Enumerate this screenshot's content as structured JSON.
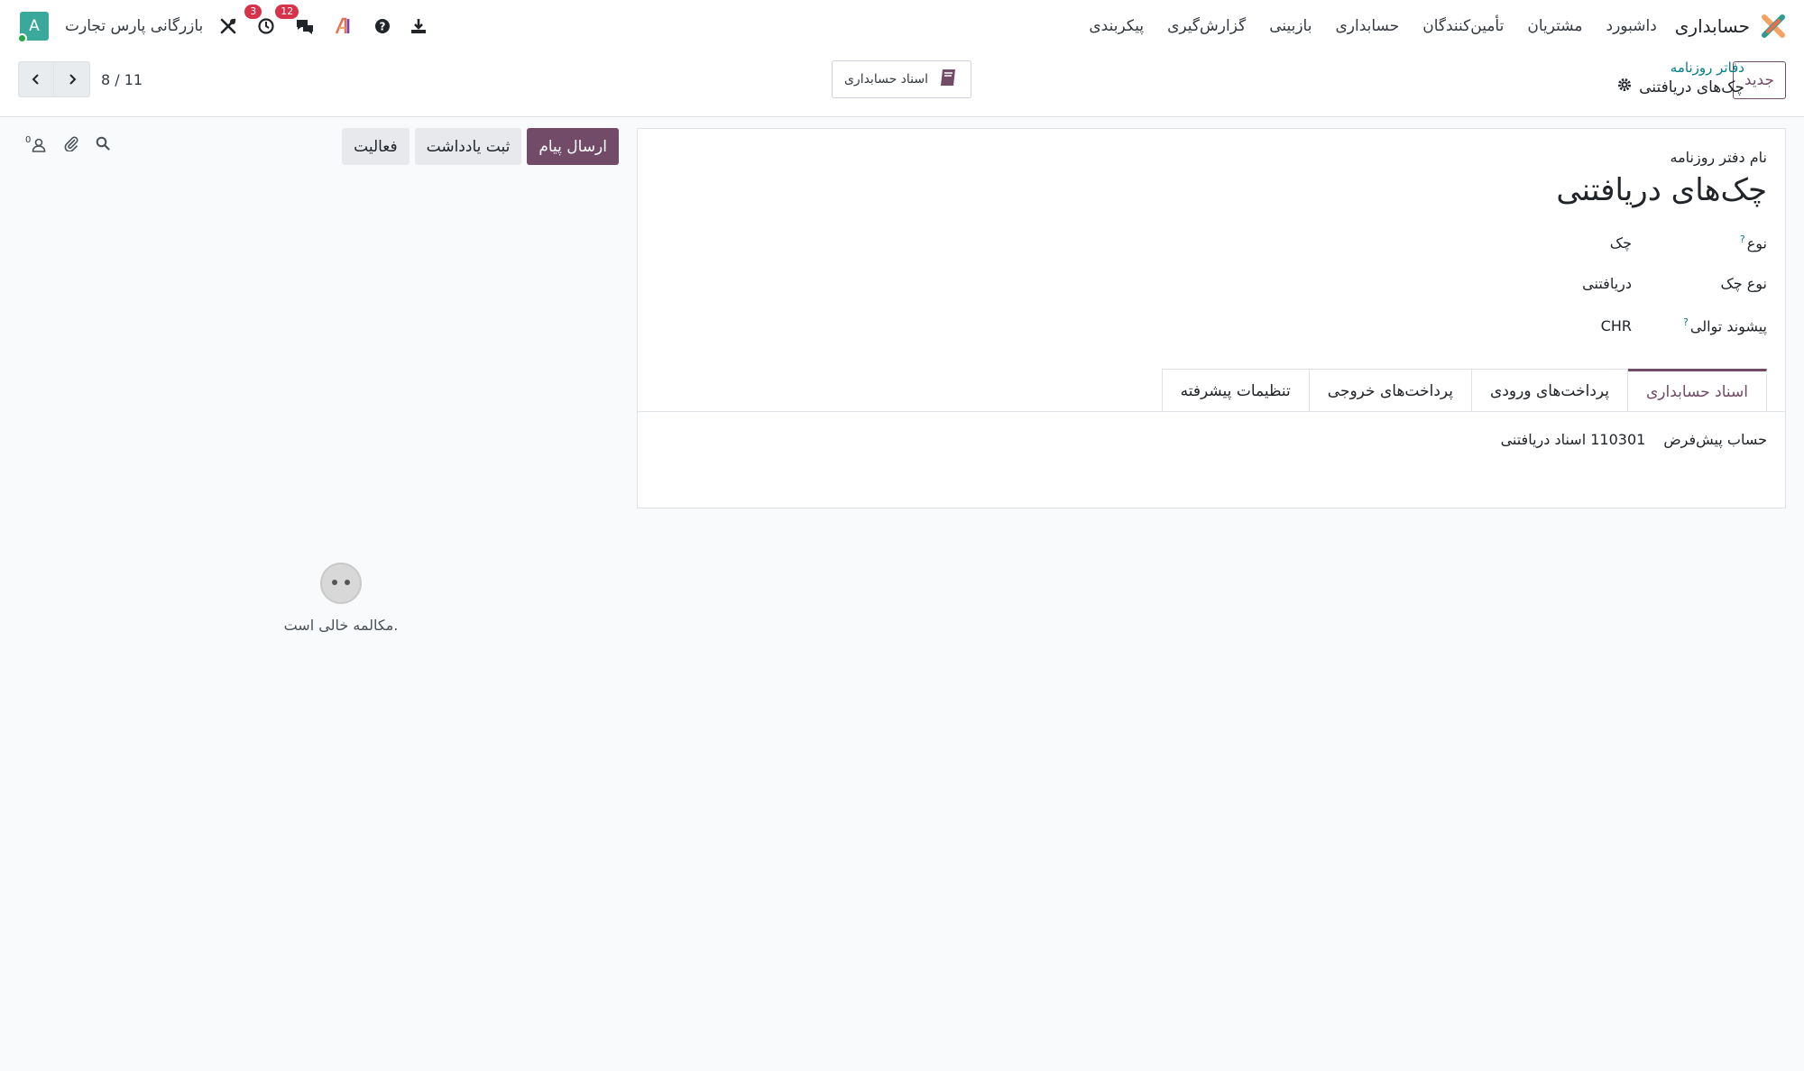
{
  "navbar": {
    "app_name": "حسابداری",
    "menu": [
      "داشبورد",
      "مشتریان",
      "تأمین‌کنندگان",
      "حسابداری",
      "بازبینی",
      "گزارش‌گیری",
      "پیکربندی"
    ],
    "company": "بازرگانی پارس تجارت",
    "avatar_letter": "A",
    "activity_badge": "3",
    "messages_badge": "12"
  },
  "control": {
    "new_button": "جدید",
    "breadcrumb_parent": "دفاتر روزنامه",
    "breadcrumb_current": "چک‌های دریافتنی",
    "smart_button": "اسناد حسابداری",
    "pager_value": "8 / 11"
  },
  "form": {
    "name_label": "نام دفتر روزنامه",
    "name_value": "چک‌های دریافتنی",
    "type_label": "نوع",
    "type_help": "?",
    "type_value": "چک",
    "check_type_label": "نوع چک",
    "check_type_value": "دریافتنی",
    "prefix_label": "پیشوند توالی",
    "prefix_help": "?",
    "prefix_value": "CHR",
    "tabs": [
      "اسناد حسابداری",
      "پرداخت‌های ورودی",
      "پرداخت‌های خروجی",
      "تنظیمات پیشرفته"
    ],
    "default_account_label": "حساب پیش‌فرض",
    "default_account_value": "110301 اسناد دریافتنی"
  },
  "chatter": {
    "send_message": "ارسال پیام",
    "log_note": "ثبت یادداشت",
    "activity": "فعالیت",
    "follower_count": "0",
    "empty_text": "مکالمه خالی است."
  },
  "colors": {
    "brand": "#714b67",
    "link": "#017e84",
    "badge": "#d6334a",
    "avatar": "#3aa89b"
  }
}
